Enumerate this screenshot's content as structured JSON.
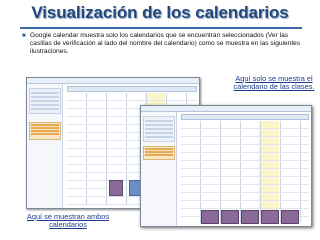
{
  "slide": {
    "title": "Visualización de los calendarios",
    "bullet": "Google calendar muestra solo los calendarios que se encuentran seleccionados (Ver las casillas de verificación al lado del nombre del calendario) como se muestra en las siguientes ilustraciones.",
    "callout_right": "Aquí solo se muestra el calendario de las clases.",
    "callout_left": "Aquí se muestran ambos calendarios"
  },
  "colors": {
    "title": "#21497e",
    "callout_text": "#1e3d8f",
    "event_purple": "#8a6a98",
    "event_blue": "#6b8ec9",
    "today_column": "#fbf6c8"
  },
  "icons": {
    "bullet": "square-bullet"
  }
}
